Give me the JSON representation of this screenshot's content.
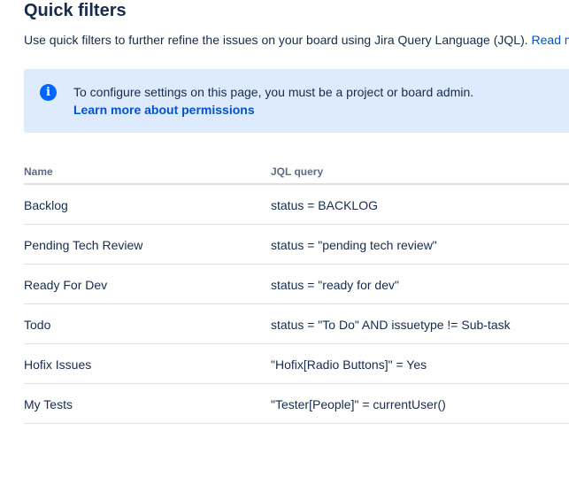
{
  "header": {
    "title": "Quick filters",
    "description": "Use quick filters to further refine the issues on your board using Jira Query Language (JQL).",
    "read_more_link": "Read mo"
  },
  "banner": {
    "icon": "info-icon",
    "icon_glyph": "i",
    "message": "To configure settings on this page, you must be a project or board admin.",
    "link_label": "Learn more about permissions",
    "background": "#deebff",
    "icon_color": "#0065ff"
  },
  "table": {
    "columns": {
      "name": "Name",
      "jql": "JQL query"
    },
    "rows": [
      {
        "name": "Backlog",
        "jql": "status = BACKLOG"
      },
      {
        "name": "Pending Tech Review",
        "jql": "status = \"pending tech review\""
      },
      {
        "name": "Ready For Dev",
        "jql": "status = \"ready for dev\""
      },
      {
        "name": "Todo",
        "jql": "status = \"To Do\" AND issuetype != Sub-task"
      },
      {
        "name": "Hofix Issues",
        "jql": "\"Hofix[Radio Buttons]\" = Yes"
      },
      {
        "name": "My Tests",
        "jql": "\"Tester[People]\" = currentUser()"
      }
    ]
  },
  "colors": {
    "text": "#172b4d",
    "link": "#0052cc",
    "header_text": "#5e6c84",
    "divider": "#dfe1e6"
  }
}
